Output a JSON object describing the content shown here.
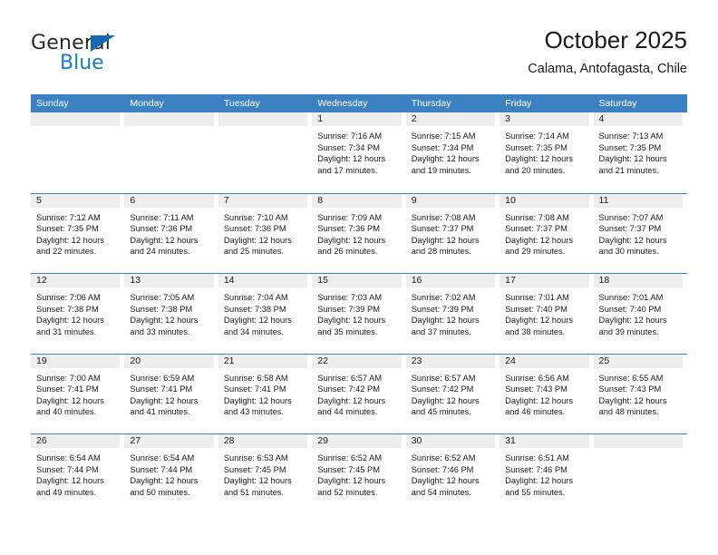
{
  "brand": {
    "name_top": "General",
    "name_bottom": "Blue",
    "triangle_icon": "brand-triangle-icon",
    "color_dark": "#2b2b2b",
    "color_blue": "#1f7ac4"
  },
  "header": {
    "title": "October 2025",
    "subtitle": "Calama, Antofagasta, Chile"
  },
  "theme": {
    "header_blue": "#3c81c1",
    "daynum_band": "#eeeeee",
    "text": "#1a1a1a"
  },
  "calendar": {
    "weekdays": [
      "Sunday",
      "Monday",
      "Tuesday",
      "Wednesday",
      "Thursday",
      "Friday",
      "Saturday"
    ],
    "weeks": [
      [
        {
          "day": "",
          "lines": []
        },
        {
          "day": "",
          "lines": []
        },
        {
          "day": "",
          "lines": []
        },
        {
          "day": "1",
          "lines": [
            "Sunrise: 7:16 AM",
            "Sunset: 7:34 PM",
            "Daylight: 12 hours",
            "and 17 minutes."
          ]
        },
        {
          "day": "2",
          "lines": [
            "Sunrise: 7:15 AM",
            "Sunset: 7:34 PM",
            "Daylight: 12 hours",
            "and 19 minutes."
          ]
        },
        {
          "day": "3",
          "lines": [
            "Sunrise: 7:14 AM",
            "Sunset: 7:35 PM",
            "Daylight: 12 hours",
            "and 20 minutes."
          ]
        },
        {
          "day": "4",
          "lines": [
            "Sunrise: 7:13 AM",
            "Sunset: 7:35 PM",
            "Daylight: 12 hours",
            "and 21 minutes."
          ]
        }
      ],
      [
        {
          "day": "5",
          "lines": [
            "Sunrise: 7:12 AM",
            "Sunset: 7:35 PM",
            "Daylight: 12 hours",
            "and 22 minutes."
          ]
        },
        {
          "day": "6",
          "lines": [
            "Sunrise: 7:11 AM",
            "Sunset: 7:36 PM",
            "Daylight: 12 hours",
            "and 24 minutes."
          ]
        },
        {
          "day": "7",
          "lines": [
            "Sunrise: 7:10 AM",
            "Sunset: 7:36 PM",
            "Daylight: 12 hours",
            "and 25 minutes."
          ]
        },
        {
          "day": "8",
          "lines": [
            "Sunrise: 7:09 AM",
            "Sunset: 7:36 PM",
            "Daylight: 12 hours",
            "and 26 minutes."
          ]
        },
        {
          "day": "9",
          "lines": [
            "Sunrise: 7:08 AM",
            "Sunset: 7:37 PM",
            "Daylight: 12 hours",
            "and 28 minutes."
          ]
        },
        {
          "day": "10",
          "lines": [
            "Sunrise: 7:08 AM",
            "Sunset: 7:37 PM",
            "Daylight: 12 hours",
            "and 29 minutes."
          ]
        },
        {
          "day": "11",
          "lines": [
            "Sunrise: 7:07 AM",
            "Sunset: 7:37 PM",
            "Daylight: 12 hours",
            "and 30 minutes."
          ]
        }
      ],
      [
        {
          "day": "12",
          "lines": [
            "Sunrise: 7:06 AM",
            "Sunset: 7:38 PM",
            "Daylight: 12 hours",
            "and 31 minutes."
          ]
        },
        {
          "day": "13",
          "lines": [
            "Sunrise: 7:05 AM",
            "Sunset: 7:38 PM",
            "Daylight: 12 hours",
            "and 33 minutes."
          ]
        },
        {
          "day": "14",
          "lines": [
            "Sunrise: 7:04 AM",
            "Sunset: 7:38 PM",
            "Daylight: 12 hours",
            "and 34 minutes."
          ]
        },
        {
          "day": "15",
          "lines": [
            "Sunrise: 7:03 AM",
            "Sunset: 7:39 PM",
            "Daylight: 12 hours",
            "and 35 minutes."
          ]
        },
        {
          "day": "16",
          "lines": [
            "Sunrise: 7:02 AM",
            "Sunset: 7:39 PM",
            "Daylight: 12 hours",
            "and 37 minutes."
          ]
        },
        {
          "day": "17",
          "lines": [
            "Sunrise: 7:01 AM",
            "Sunset: 7:40 PM",
            "Daylight: 12 hours",
            "and 38 minutes."
          ]
        },
        {
          "day": "18",
          "lines": [
            "Sunrise: 7:01 AM",
            "Sunset: 7:40 PM",
            "Daylight: 12 hours",
            "and 39 minutes."
          ]
        }
      ],
      [
        {
          "day": "19",
          "lines": [
            "Sunrise: 7:00 AM",
            "Sunset: 7:41 PM",
            "Daylight: 12 hours",
            "and 40 minutes."
          ]
        },
        {
          "day": "20",
          "lines": [
            "Sunrise: 6:59 AM",
            "Sunset: 7:41 PM",
            "Daylight: 12 hours",
            "and 41 minutes."
          ]
        },
        {
          "day": "21",
          "lines": [
            "Sunrise: 6:58 AM",
            "Sunset: 7:41 PM",
            "Daylight: 12 hours",
            "and 43 minutes."
          ]
        },
        {
          "day": "22",
          "lines": [
            "Sunrise: 6:57 AM",
            "Sunset: 7:42 PM",
            "Daylight: 12 hours",
            "and 44 minutes."
          ]
        },
        {
          "day": "23",
          "lines": [
            "Sunrise: 6:57 AM",
            "Sunset: 7:42 PM",
            "Daylight: 12 hours",
            "and 45 minutes."
          ]
        },
        {
          "day": "24",
          "lines": [
            "Sunrise: 6:56 AM",
            "Sunset: 7:43 PM",
            "Daylight: 12 hours",
            "and 46 minutes."
          ]
        },
        {
          "day": "25",
          "lines": [
            "Sunrise: 6:55 AM",
            "Sunset: 7:43 PM",
            "Daylight: 12 hours",
            "and 48 minutes."
          ]
        }
      ],
      [
        {
          "day": "26",
          "lines": [
            "Sunrise: 6:54 AM",
            "Sunset: 7:44 PM",
            "Daylight: 12 hours",
            "and 49 minutes."
          ]
        },
        {
          "day": "27",
          "lines": [
            "Sunrise: 6:54 AM",
            "Sunset: 7:44 PM",
            "Daylight: 12 hours",
            "and 50 minutes."
          ]
        },
        {
          "day": "28",
          "lines": [
            "Sunrise: 6:53 AM",
            "Sunset: 7:45 PM",
            "Daylight: 12 hours",
            "and 51 minutes."
          ]
        },
        {
          "day": "29",
          "lines": [
            "Sunrise: 6:52 AM",
            "Sunset: 7:45 PM",
            "Daylight: 12 hours",
            "and 52 minutes."
          ]
        },
        {
          "day": "30",
          "lines": [
            "Sunrise: 6:52 AM",
            "Sunset: 7:46 PM",
            "Daylight: 12 hours",
            "and 54 minutes."
          ]
        },
        {
          "day": "31",
          "lines": [
            "Sunrise: 6:51 AM",
            "Sunset: 7:46 PM",
            "Daylight: 12 hours",
            "and 55 minutes."
          ]
        },
        {
          "day": "",
          "lines": []
        }
      ]
    ]
  }
}
